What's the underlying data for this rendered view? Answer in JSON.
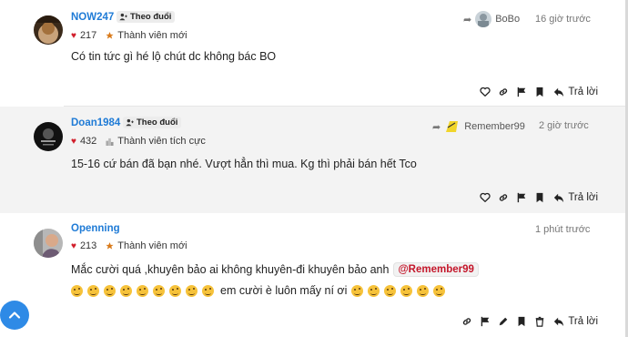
{
  "posts": [
    {
      "username": "NOW247",
      "follow_label": "Theo đuổi",
      "likes": "217",
      "rank": "Thành viên mới",
      "reply_to": "BoBo",
      "time": "16 giờ trước",
      "body": "Có tin tức gì hé lộ chút dc không bác BO",
      "reply_label": "Trả lời"
    },
    {
      "username": "Doan1984",
      "follow_label": "Theo đuổi",
      "likes": "432",
      "rank": "Thành viên tích cực",
      "reply_to": "Remember99",
      "time": "2 giờ trước",
      "body": "15-16 cứ bán đã bạn nhé. Vượt hẳn thì mua. Kg thì phải bán hết Tco",
      "reply_label": "Trả lời"
    },
    {
      "username": "Openning",
      "likes": "213",
      "rank": "Thành viên mới",
      "time": "1 phút trước",
      "body": "Mắc cười quá ,khuyên bảo ai không khuyên-đi khuyên bảo anh",
      "mention": "@Remember99",
      "emoji_line_text": "em cười è luôn mấy ní ơi",
      "reply_label": "Trả lời"
    }
  ],
  "icons": {
    "like": "heart-outline-icon",
    "link": "link-icon",
    "flag": "flag-icon",
    "bookmark": "bookmark-icon",
    "edit": "pencil-icon",
    "delete": "trash-icon",
    "reply": "reply-icon",
    "emoji": "rolling-laughing-emoji"
  },
  "colors": {
    "username": "#1f7bd6",
    "heart": "#d11e2b",
    "mention": "#c4162a",
    "scroll_button": "#2e8ae6",
    "highlight_bg": "#f3f3f3"
  }
}
